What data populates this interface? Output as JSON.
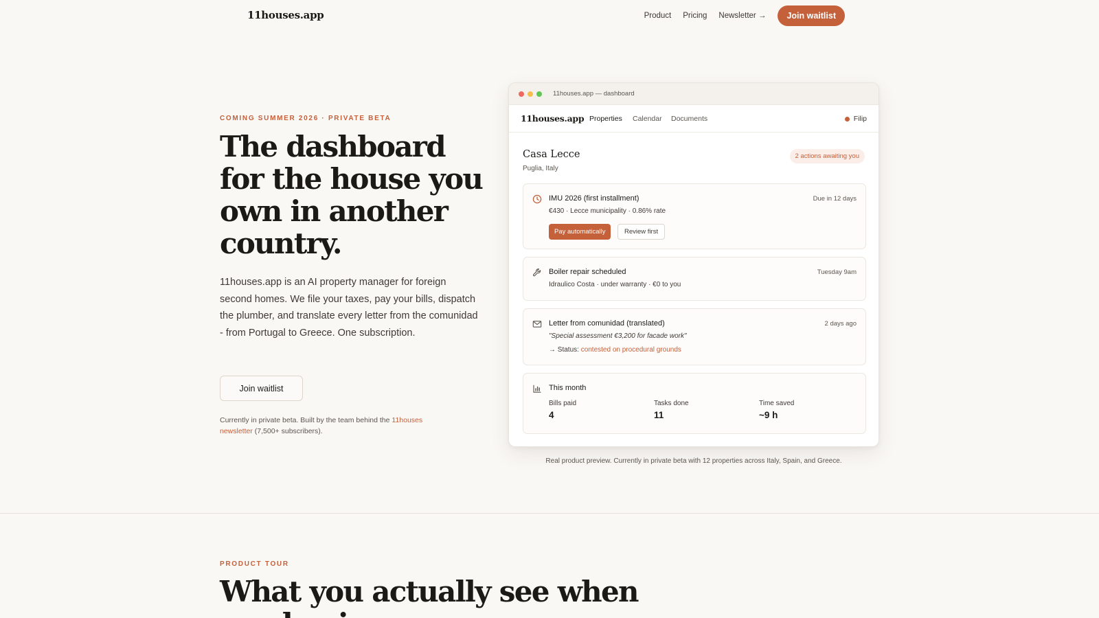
{
  "nav": {
    "brand": "11houses.app",
    "links": [
      "Product",
      "Pricing",
      "Newsletter →"
    ],
    "cta": "Join waitlist"
  },
  "hero": {
    "eyebrow": "COMING SUMMER 2026 · PRIVATE BETA",
    "title": "The dashboard for the house you own in another country.",
    "description": "11houses.app is an AI property manager for foreign second homes. We file your taxes, pay your bills, dispatch the plumber, and translate every letter from the comunidad - from Portugal to Greece. One subscription.",
    "button": "Join waitlist",
    "note_prefix": "Currently in private beta. Built by the team behind the ",
    "note_link": "11houses newsletter",
    "note_suffix": " (7,500+ subscribers)."
  },
  "window": {
    "title": "11houses.app — dashboard",
    "dot_colors": [
      "#ee6a5f",
      "#f5bf4f",
      "#61c554"
    ],
    "app_brand": "11houses.app",
    "tabs": [
      "Properties",
      "Calendar",
      "Documents"
    ],
    "active_tab": "Properties",
    "user": "Filip",
    "property": {
      "name": "Casa Lecce",
      "location": "Puglia, Italy",
      "badge": "2 actions awaiting you"
    },
    "cards": [
      {
        "icon": "clock-icon",
        "title": "IMU 2026 (first installment)",
        "meta": "Due in 12 days",
        "sub": "€430 · Lecce municipality · 0.86% rate",
        "primary_button": "Pay automatically",
        "secondary_button": "Review first"
      },
      {
        "icon": "wrench-icon",
        "title": "Boiler repair scheduled",
        "meta": "Tuesday 9am",
        "sub": "Idraulico Costa · under warranty · €0 to you"
      },
      {
        "icon": "mail-icon",
        "title": "Letter from comunidad (translated)",
        "meta": "2 days ago",
        "quote": "\"Special assessment €3,200 for facade work\"",
        "status_prefix": "→ Status: ",
        "status_link": "contested on procedural grounds"
      },
      {
        "icon": "bar-chart-icon",
        "title": "This month",
        "stats": [
          {
            "label": "Bills paid",
            "value": "4"
          },
          {
            "label": "Tasks done",
            "value": "11"
          },
          {
            "label": "Time saved",
            "value": "~9 h"
          }
        ]
      }
    ]
  },
  "preview_caption": "Real product preview. Currently in private beta with 12 properties across Italy, Spain, and Greece.",
  "tour": {
    "eyebrow": "PRODUCT TOUR",
    "title": "What you actually see when you log in"
  },
  "colors": {
    "accent": "#c4603a",
    "background": "#faf8f5",
    "text": "#1c1a17"
  }
}
